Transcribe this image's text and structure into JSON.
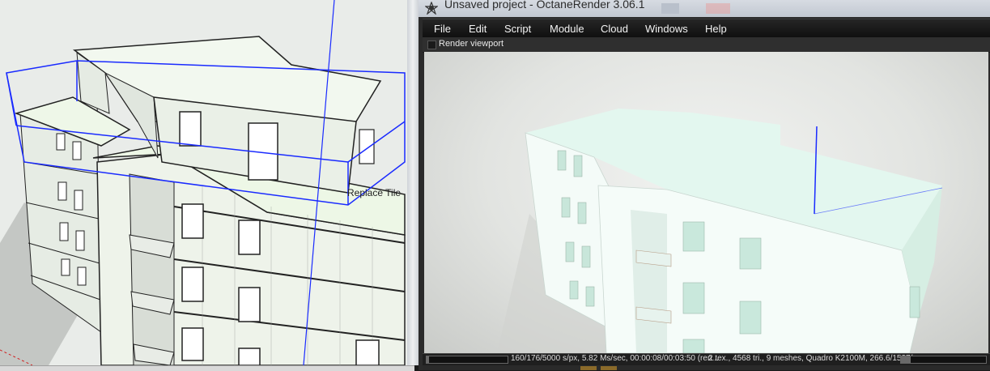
{
  "modeler": {
    "tooltip": "Replace Tile",
    "axis_colors": {
      "blue": "#1a2bff",
      "red": "#d02020"
    }
  },
  "window": {
    "title": "Unsaved project - OctaneRender 3.06.1",
    "icon": "octane-logo-icon"
  },
  "menu": {
    "items": [
      "File",
      "Edit",
      "Script",
      "Module",
      "Cloud",
      "Windows",
      "Help"
    ]
  },
  "panel": {
    "title": "Render viewport",
    "checkbox_checked": false
  },
  "status": {
    "left": "160/176/5000 s/px, 5.82 Ms/sec, 00:00:08/00:03:50 (ren...",
    "right": "2 tex., 4568 tri., 9 meshes, Quadro K2100M, 266.6/1537/...",
    "samples_done": 160,
    "samples_total": 5000
  },
  "colors": {
    "menubar": "#141414",
    "viewport_bg": "#e4e5e3",
    "building": "#eefbf5"
  }
}
